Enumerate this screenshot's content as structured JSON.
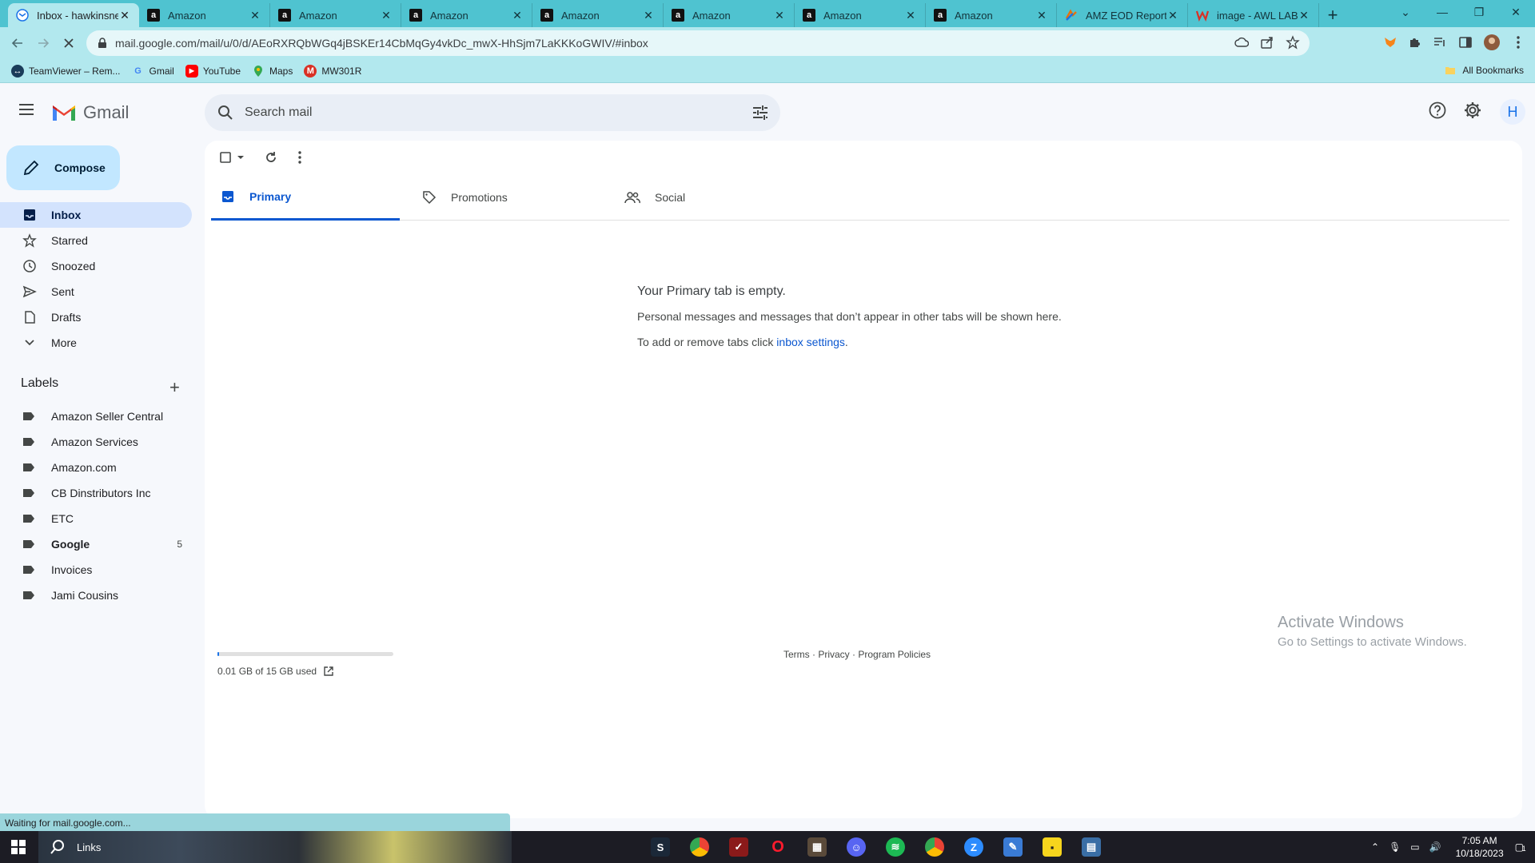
{
  "browser": {
    "tabs": [
      {
        "title": "Inbox - hawkinsne",
        "favicon": "gmail",
        "active": true
      },
      {
        "title": "Amazon",
        "favicon": "amazon"
      },
      {
        "title": "Amazon",
        "favicon": "amazon"
      },
      {
        "title": "Amazon",
        "favicon": "amazon"
      },
      {
        "title": "Amazon",
        "favicon": "amazon"
      },
      {
        "title": "Amazon",
        "favicon": "amazon"
      },
      {
        "title": "Amazon",
        "favicon": "amazon"
      },
      {
        "title": "Amazon",
        "favicon": "amazon"
      },
      {
        "title": "AMZ EOD Report",
        "favicon": "report"
      },
      {
        "title": "image - AWL LAB",
        "favicon": "awl"
      }
    ],
    "url": "mail.google.com/mail/u/0/d/AEoRXRQbWGq4jBSKEr14CbMqGy4vkDc_mwX-HhSjm7LaKKKoGWIV/#inbox",
    "bookmarks": [
      {
        "label": "TeamViewer – Rem...",
        "icon": "teamviewer-icon"
      },
      {
        "label": "Gmail",
        "icon": "google-icon"
      },
      {
        "label": "YouTube",
        "icon": "youtube-icon"
      },
      {
        "label": "Maps",
        "icon": "maps-icon"
      },
      {
        "label": "MW301R",
        "icon": "mercusys-icon"
      }
    ],
    "all_bookmarks": "All Bookmarks",
    "status": "Waiting for mail.google.com..."
  },
  "gmail": {
    "logo_text": "Gmail",
    "search_placeholder": "Search mail",
    "avatar_letter": "H",
    "compose": "Compose",
    "nav": [
      {
        "label": "Inbox",
        "icon": "inbox-icon",
        "active": true
      },
      {
        "label": "Starred",
        "icon": "star-icon"
      },
      {
        "label": "Snoozed",
        "icon": "clock-icon"
      },
      {
        "label": "Sent",
        "icon": "send-icon"
      },
      {
        "label": "Drafts",
        "icon": "draft-icon"
      },
      {
        "label": "More",
        "icon": "chevron-down-icon"
      }
    ],
    "labels_title": "Labels",
    "labels": [
      {
        "label": "Amazon Seller Central"
      },
      {
        "label": "Amazon Services"
      },
      {
        "label": "Amazon.com"
      },
      {
        "label": "CB Dinstributors Inc"
      },
      {
        "label": "ETC"
      },
      {
        "label": "Google",
        "count": "5",
        "bold": true
      },
      {
        "label": "Invoices"
      },
      {
        "label": "Jami Cousins"
      }
    ],
    "category_tabs": [
      {
        "label": "Primary",
        "icon": "inbox-icon",
        "active": true
      },
      {
        "label": "Promotions",
        "icon": "tag-icon"
      },
      {
        "label": "Social",
        "icon": "people-icon"
      }
    ],
    "empty_title": "Your Primary tab is empty.",
    "empty_line1": "Personal messages and messages that don’t appear in other tabs will be shown here.",
    "empty_line2_prefix": "To add or remove tabs click ",
    "empty_line2_link": "inbox settings",
    "empty_line2_suffix": ".",
    "storage_text": "0.01 GB of 15 GB used",
    "storage_fraction": 0.001,
    "footer": {
      "terms": "Terms",
      "privacy": "Privacy",
      "policies": "Program Policies",
      "sep": " · "
    }
  },
  "watermark": {
    "line1": "Activate Windows",
    "line2": "Go to Settings to activate Windows."
  },
  "taskbar": {
    "search_label": "Links",
    "time": "7:05 AM",
    "date": "10/18/2023",
    "notification_count": "1"
  },
  "colors": {
    "accent": "#0b57d0",
    "compose_bg": "#c2e7ff",
    "browser_frame": "#4fc3d0",
    "toolbar": "#b2e8ee"
  }
}
